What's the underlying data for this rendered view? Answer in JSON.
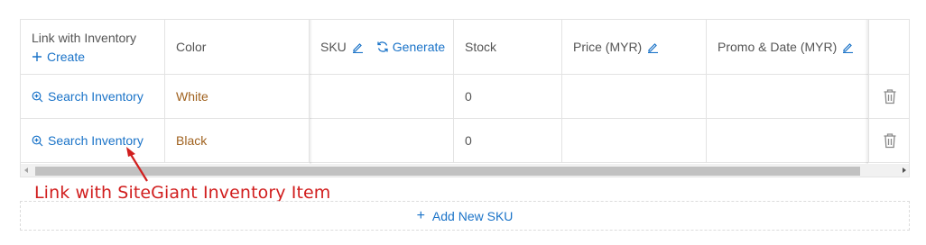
{
  "table": {
    "headers": {
      "link_inventory": "Link with Inventory",
      "create": "Create",
      "color": "Color",
      "sku": "SKU",
      "generate": "Generate",
      "stock": "Stock",
      "price": "Price (MYR)",
      "promo": "Promo & Date (MYR)"
    },
    "rows": [
      {
        "link": "Search Inventory",
        "color": "White",
        "sku": "",
        "stock": "0",
        "price": "",
        "promo": ""
      },
      {
        "link": "Search Inventory",
        "color": "Black",
        "sku": "",
        "stock": "0",
        "price": "",
        "promo": ""
      }
    ]
  },
  "annotation": "Link with SiteGiant Inventory Item",
  "footer": {
    "add_sku": "Add New SKU"
  },
  "colors": {
    "accent": "#1a73c8",
    "variant_text": "#a0621f",
    "annotation": "#d11e1e"
  },
  "icons": [
    "plus-icon",
    "pencil-icon",
    "refresh-icon",
    "zoom-in-icon",
    "trash-icon",
    "arrow-icon"
  ]
}
